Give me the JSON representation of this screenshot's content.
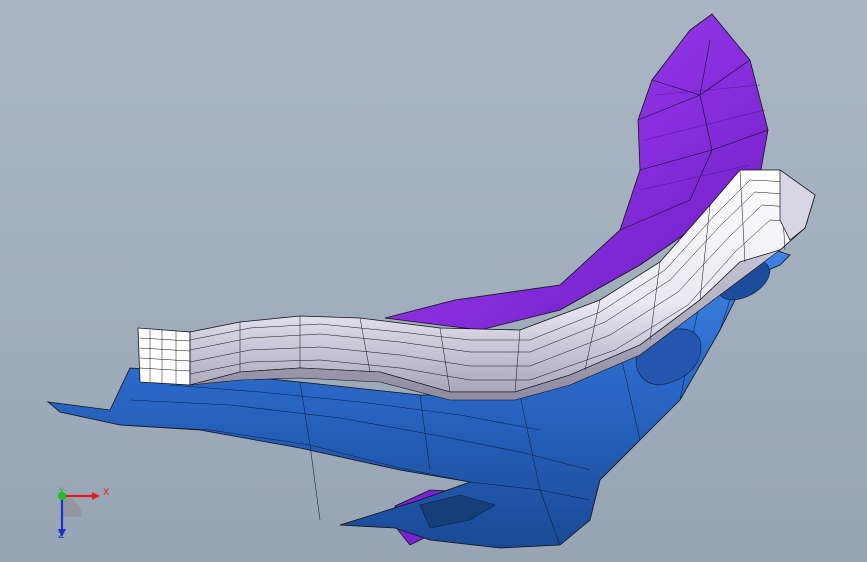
{
  "viewport": {
    "colors": {
      "background": "#a3b0be",
      "shell": "#2f6fcf",
      "shell_dark": "#163f7a",
      "trim": "#f0f0f6",
      "trim_shadow": "#9a98ad",
      "back": "#8a2fe0",
      "back_dark": "#5b14a8",
      "edge": "#111111"
    }
  },
  "triad": {
    "x_label": "X",
    "y_label": "Y",
    "z_label": "Z",
    "colors": {
      "x": "#e01c1c",
      "y": "#18c218",
      "z": "#1a2fd6"
    }
  }
}
